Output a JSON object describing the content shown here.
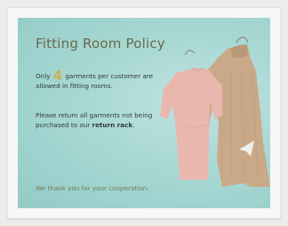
{
  "sign": {
    "title": "Fitting Room Policy",
    "p1_a": "Only ",
    "p1_num": "4",
    "p1_b": " garments per customer are allowed in fitting rooms.",
    "p2_a": "Please return all garments not being purchased to our ",
    "p2_bold": "return rack",
    "p2_end": ".",
    "thanks": "We thank you for your cooperation."
  },
  "colors": {
    "background": "#a8d8d4",
    "title": "#6a6a4a",
    "number": "#c7b25a",
    "pink_dress": "#eab7ae",
    "tan_dress": "#c9a988"
  },
  "icons": [
    "hanger-icon",
    "dress-icon",
    "sweater-dress-icon",
    "paper-plane-icon"
  ]
}
